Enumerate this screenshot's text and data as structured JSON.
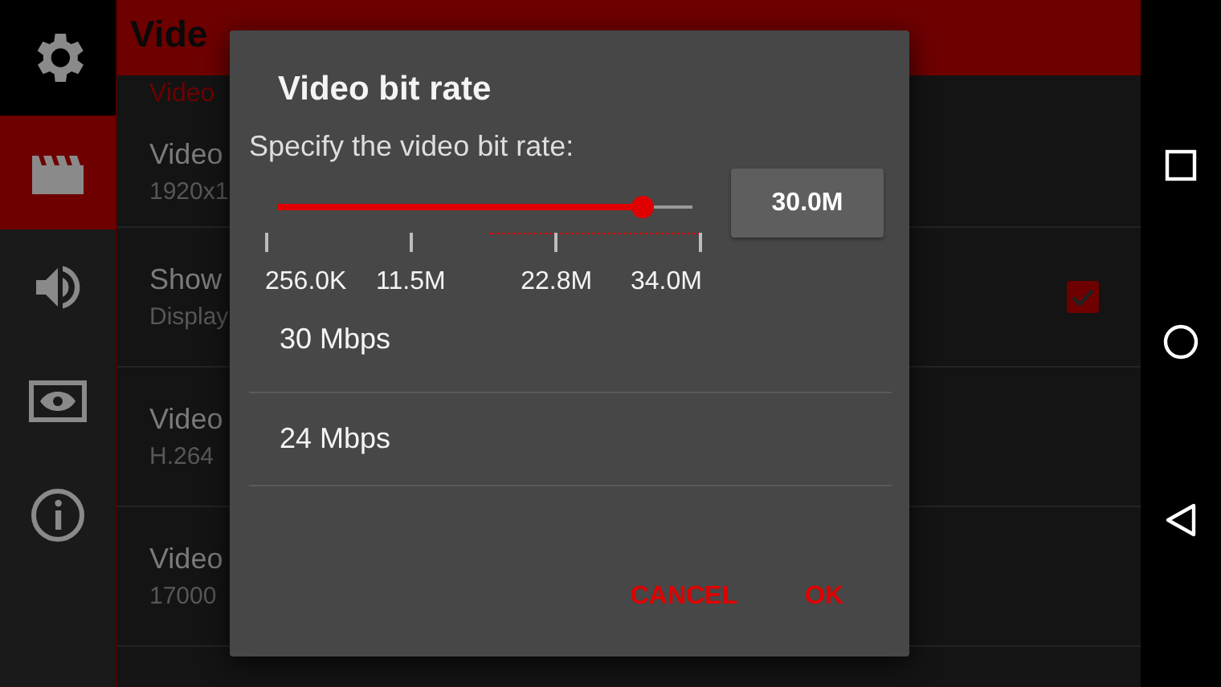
{
  "sidebar": {
    "items": [
      {
        "kind": "gear",
        "selected": false
      },
      {
        "kind": "clapperboard",
        "selected": true
      },
      {
        "kind": "speaker",
        "selected": false
      },
      {
        "kind": "eye",
        "selected": false
      },
      {
        "kind": "info",
        "selected": false
      }
    ]
  },
  "header": {
    "title": "Vide",
    "subtitle": "Video"
  },
  "settings": [
    {
      "kind": "text",
      "title": "Video",
      "summary": "1920x1"
    },
    {
      "kind": "checkbox",
      "title": "Show",
      "summary": "Display",
      "checked": true
    },
    {
      "kind": "text",
      "title": "Video",
      "summary": "H.264"
    },
    {
      "kind": "text",
      "title": "Video",
      "summary": "17000"
    }
  ],
  "dialog": {
    "title": "Video bit rate",
    "message": "Specify the video bit rate:",
    "slider": {
      "level": 0.88
    },
    "ticks": [
      "256.0K",
      "11.5M",
      "22.8M",
      "34.0M"
    ],
    "value": "30.0M",
    "presets": [
      {
        "label": "30 Mbps"
      },
      {
        "label": "24 Mbps"
      }
    ],
    "buttons": [
      "CANCEL",
      "OK"
    ]
  }
}
